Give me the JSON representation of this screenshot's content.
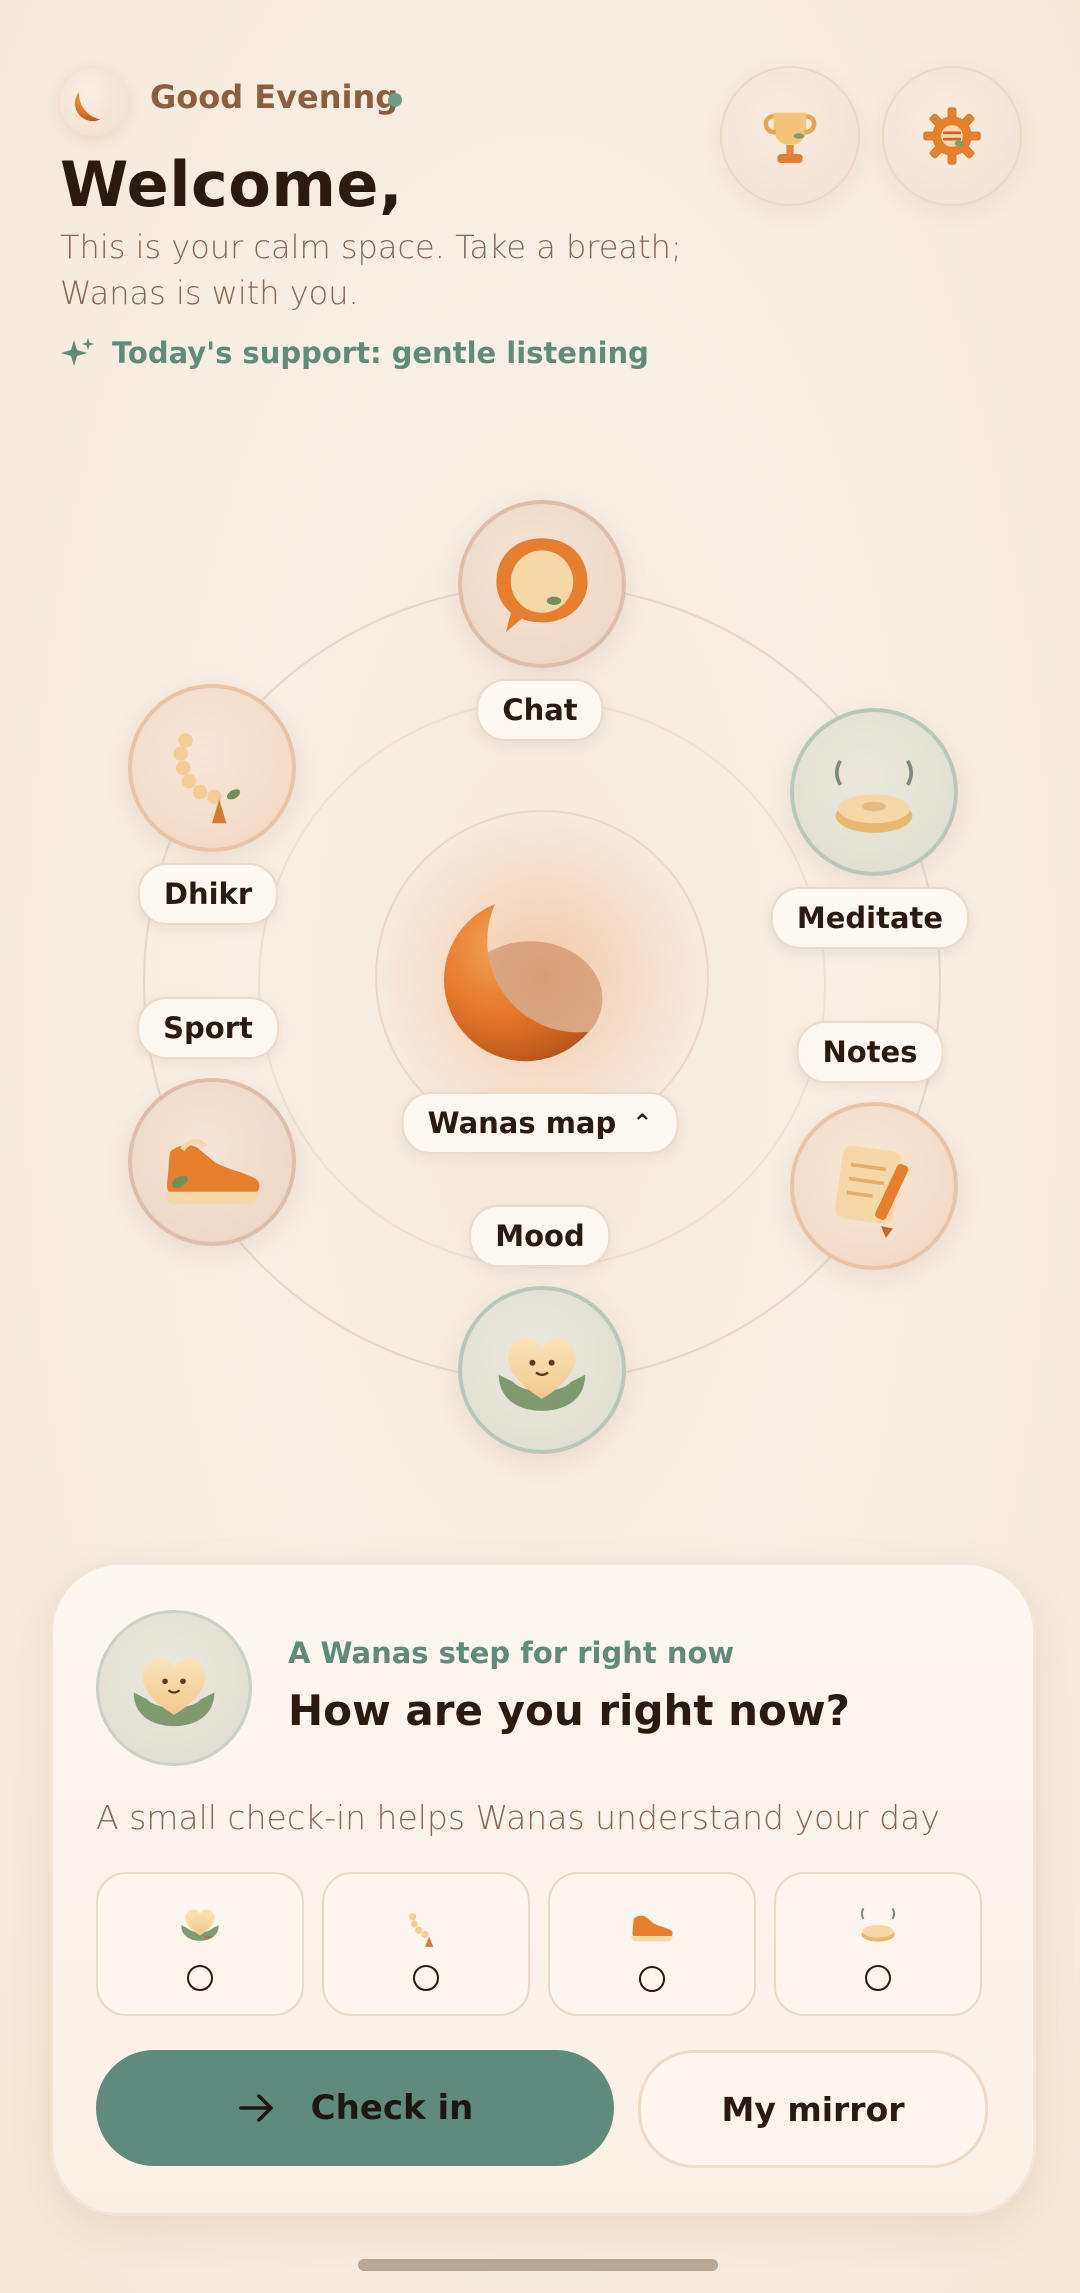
{
  "header": {
    "greeting": "Good Evening",
    "welcome": "Welcome,",
    "subtitle": "This is your calm space. Take a breath; Wanas is with you.",
    "support": "Today's support: gentle listening"
  },
  "top_actions": [
    {
      "name": "achievements",
      "icon": "trophy-icon"
    },
    {
      "name": "settings",
      "icon": "gear-icon"
    }
  ],
  "map": {
    "center_label": "Wanas map",
    "nodes": {
      "chat": "Chat",
      "dhikr": "Dhikr",
      "meditate": "Meditate",
      "sport": "Sport",
      "notes": "Notes",
      "mood": "Mood"
    }
  },
  "card": {
    "kicker": "A Wanas step for right now",
    "title": "How are you right now?",
    "description": "A small check-in helps Wanas understand your day",
    "options": [
      {
        "icon": "heart-mood-icon",
        "selected": false
      },
      {
        "icon": "prayer-beads-icon",
        "selected": false
      },
      {
        "icon": "sneaker-icon",
        "selected": false
      },
      {
        "icon": "meditation-cushion-icon",
        "selected": false
      }
    ],
    "primary_button": "Check in",
    "secondary_button": "My mirror"
  },
  "colors": {
    "accent_sage": "#5f8a7e",
    "accent_orange": "#e57f2e",
    "text_dark": "#2b1a10",
    "text_brown": "#8a6550"
  }
}
